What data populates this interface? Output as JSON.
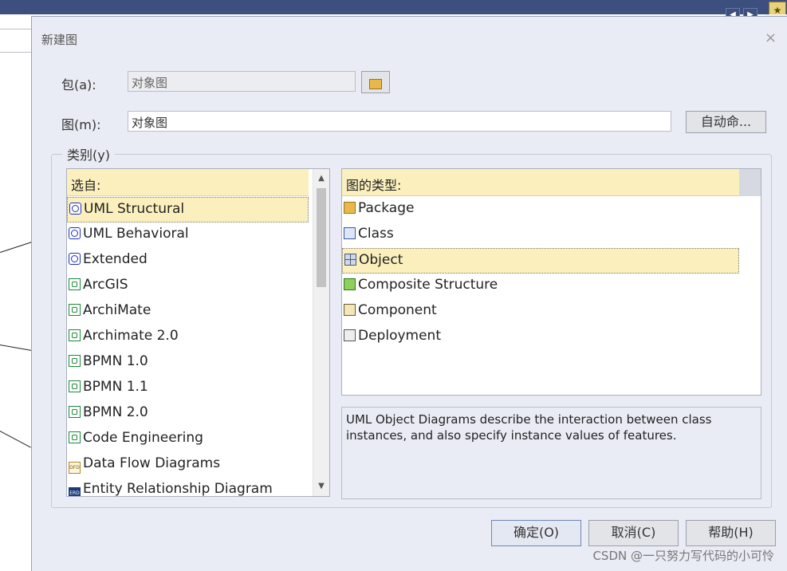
{
  "dialog": {
    "title": "新建图",
    "close_glyph": "×",
    "package_label": "包(a):",
    "package_value": "对象图",
    "diagram_label": "图(m):",
    "diagram_value": "对象图",
    "autoname_label": "自动命...",
    "category_label": "类别(y)"
  },
  "select_from": {
    "header": "选自:",
    "items": [
      {
        "label": "UML Structural",
        "icon": "uml-icon",
        "selected": true
      },
      {
        "label": "UML Behavioral",
        "icon": "uml-icon"
      },
      {
        "label": "Extended",
        "icon": "uml-icon"
      },
      {
        "label": "ArcGIS",
        "icon": "technology-icon"
      },
      {
        "label": "ArchiMate",
        "icon": "technology-icon"
      },
      {
        "label": "Archimate 2.0",
        "icon": "technology-icon"
      },
      {
        "label": "BPMN 1.0",
        "icon": "technology-icon"
      },
      {
        "label": "BPMN 1.1",
        "icon": "technology-icon"
      },
      {
        "label": "BPMN 2.0",
        "icon": "technology-icon"
      },
      {
        "label": "Code Engineering",
        "icon": "technology-icon"
      },
      {
        "label": "Data Flow Diagrams",
        "icon": "dfd-icon"
      },
      {
        "label": "Entity Relationship Diagram",
        "icon": "erd-icon"
      }
    ]
  },
  "diagram_types": {
    "header": "图的类型:",
    "items": [
      {
        "label": "Package",
        "icon": "package-icon"
      },
      {
        "label": "Class",
        "icon": "class-icon"
      },
      {
        "label": "Object",
        "icon": "object-icon",
        "selected": true
      },
      {
        "label": "Composite Structure",
        "icon": "composite-structure-icon"
      },
      {
        "label": "Component",
        "icon": "component-icon"
      },
      {
        "label": "Deployment",
        "icon": "deployment-icon"
      }
    ]
  },
  "description": "UML Object Diagrams describe the interaction between class instances, and also specify instance values of features.",
  "buttons": {
    "ok": "确定(O)",
    "cancel": "取消(C)",
    "help": "帮助(H)"
  },
  "watermark": "CSDN @一只努力写代码的小可怜",
  "colors": {
    "selection": "#fbf0bd",
    "dialog_bg": "#e9ecf4",
    "app_titlebar": "#3d4f7f"
  }
}
